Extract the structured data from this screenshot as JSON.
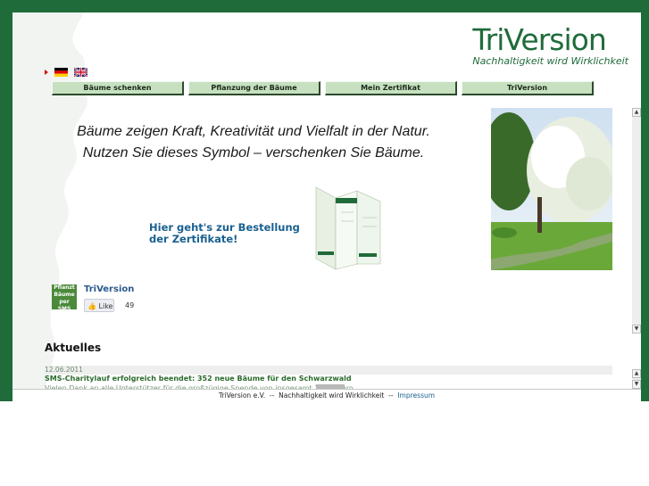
{
  "logo": {
    "brand_tri": "Tri",
    "brand_version": "Version",
    "slogan": "Nachhaltigkeit wird Wirklichkeit"
  },
  "languages": [
    {
      "name": "Deutsch",
      "icon": "german-flag-icon"
    },
    {
      "name": "English",
      "icon": "uk-flag-icon"
    }
  ],
  "nav": [
    "Bäume schenken",
    "Pflanzung der Bäume",
    "Mein Zertifikat",
    "TriVersion"
  ],
  "hero": {
    "line1": "Bäume zeigen Kraft, Kreativität und Vielfalt in der Natur.",
    "line2": "Nutzen Sie dieses Symbol – verschenken Sie Bäume.",
    "order_link": "Hier geht's zur Bestellung der Zertifikate!"
  },
  "facebook": {
    "thumb_text": "Pflanzt Bäume per SMS",
    "page_name": "TriVersion",
    "like_label": "Like",
    "like_count": "49"
  },
  "news": {
    "heading": "Aktuelles",
    "items": [
      {
        "date": "12.06.2011",
        "title": "SMS-Charitylauf erfolgreich beendet: 352 neue Bäume für den Schwarzwald",
        "text": "Vielen Dank an alle Unterstützer für die großzügige Spende von insgesamt 1.760 Euro."
      }
    ]
  },
  "footer": {
    "org": "TriVersion",
    "org_suffix": "e.V.",
    "sep": "--",
    "slogan": "Nachhaltigkeit wird Wirklichkeit",
    "impressum": "Impressum"
  },
  "colors": {
    "frame": "#1f6b3a",
    "nav_bg": "#c6e0c0",
    "link": "#1a6090"
  }
}
